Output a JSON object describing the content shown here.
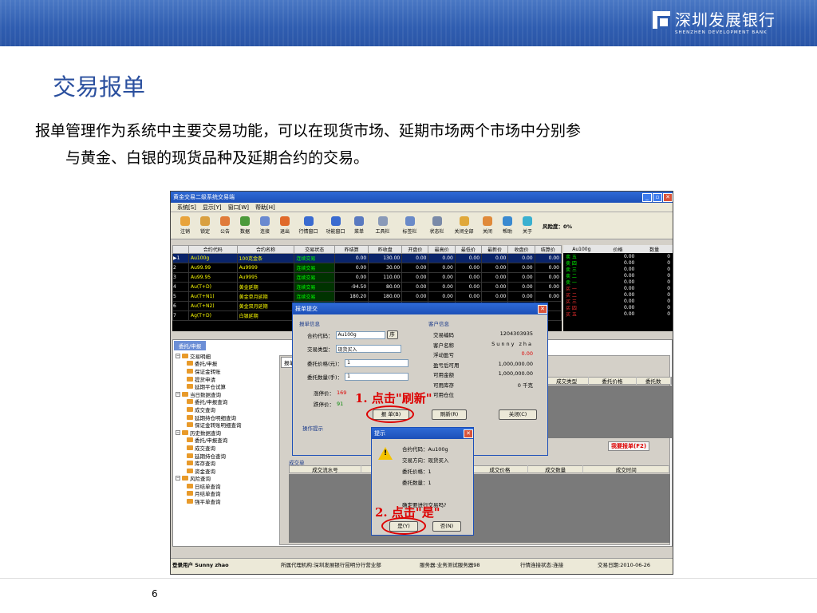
{
  "slide": {
    "title": "交易报单",
    "intro_line1": "报单管理作为系统中主要交易功能，可以在现货市场、延期市场两个市场中分别参",
    "intro_line2": "与黄金、白银的现货品种及延期合约的交易。",
    "page_number": "6",
    "logo_cn": "深圳发展银行",
    "logo_en": "SHENZHEN DEVELOPMENT BANK"
  },
  "app": {
    "title": "黄金交易二级系统交易端",
    "menu": [
      "系统[S]",
      "显示[Y]",
      "窗口[W]",
      "帮助[H]"
    ],
    "toolbar": [
      "注销",
      "锁定",
      "公告",
      "数据",
      "连接",
      "退出",
      "行情窗口",
      "功能窗口",
      "菜单",
      "工具栏",
      "标签栏",
      "状态栏",
      "关闭全部",
      "关闭",
      "帮助",
      "关于"
    ],
    "risk": "风险度：0%",
    "quote_headers": [
      "",
      "合约代码",
      "合约名称",
      "交易状态",
      "昨结算",
      "昨收盘",
      "开盘价",
      "最高价",
      "最低价",
      "最新价",
      "收盘价",
      "结算价"
    ],
    "quote_rows": [
      [
        "▶1",
        "Au100g",
        "100克金条",
        "连续交易",
        "0.00",
        "130.00",
        "0.00",
        "0.00",
        "0.00",
        "0.00",
        "0.00",
        "0.00"
      ],
      [
        "2",
        "Au99.99",
        "Au9999",
        "连续交易",
        "0.00",
        "30.00",
        "0.00",
        "0.00",
        "0.00",
        "0.00",
        "0.00",
        "0.00"
      ],
      [
        "3",
        "Au99.95",
        "Au9995",
        "连续交易",
        "0.00",
        "110.00",
        "0.00",
        "0.00",
        "0.00",
        "0.00",
        "0.00",
        "0.00"
      ],
      [
        "4",
        "Au(T+D)",
        "黄金延期",
        "连续交易",
        "-94.50",
        "80.00",
        "0.00",
        "0.00",
        "0.00",
        "0.00",
        "0.00",
        "0.00"
      ],
      [
        "5",
        "Au(T+N1)",
        "黄金单月延期",
        "连续交易",
        "180.20",
        "180.00",
        "0.00",
        "0.00",
        "0.00",
        "0.00",
        "0.00",
        "0.00"
      ],
      [
        "6",
        "Au(T+N2)",
        "黄金双月延期",
        "连续交",
        "",
        "",
        "",
        "",
        "",
        "",
        "",
        ""
      ],
      [
        "7",
        "Ag(T+D)",
        "白银延期",
        "连续交",
        "",
        "",
        "",
        "",
        "",
        "",
        "",
        ""
      ]
    ],
    "depth": {
      "contract": "Au100g",
      "headers": [
        "Au100g",
        "价格",
        "数量"
      ],
      "rows": [
        [
          "卖 五",
          "0.00",
          "0"
        ],
        [
          "卖 四",
          "0.00",
          "0"
        ],
        [
          "卖 三",
          "0.00",
          "0"
        ],
        [
          "卖 二",
          "0.00",
          "0"
        ],
        [
          "卖 一",
          "0.00",
          "0"
        ],
        [
          "买 一",
          "0.00",
          "0"
        ],
        [
          "买 二",
          "0.00",
          "0"
        ],
        [
          "买 三",
          "0.00",
          "0"
        ],
        [
          "买 四",
          "0.00",
          "0"
        ],
        [
          "买 五",
          "0.00",
          "0"
        ]
      ]
    },
    "lower_tab": "委托/申报",
    "tree": [
      {
        "label": "交易明细",
        "level": 0,
        "exp": true
      },
      {
        "label": "委托/申报",
        "level": 1
      },
      {
        "label": "保证金转账",
        "level": 1
      },
      {
        "label": "提货申请",
        "level": 1
      },
      {
        "label": "延期平仓试算",
        "level": 1
      },
      {
        "label": "当日数据查询",
        "level": 0,
        "exp": true
      },
      {
        "label": "委托/申报查询",
        "level": 1
      },
      {
        "label": "成交查询",
        "level": 1
      },
      {
        "label": "延期持仓明细查询",
        "level": 1
      },
      {
        "label": "保证金转账明细查询",
        "level": 1
      },
      {
        "label": "历史数据查询",
        "level": 0,
        "exp": true
      },
      {
        "label": "委托/申报查询",
        "level": 1
      },
      {
        "label": "成交查询",
        "level": 1
      },
      {
        "label": "延期持仓查询",
        "level": 1
      },
      {
        "label": "库存查询",
        "level": 1
      },
      {
        "label": "资金查询",
        "level": 1
      },
      {
        "label": "风险查询",
        "level": 0,
        "exp": true
      },
      {
        "label": "日结单查询",
        "level": 1
      },
      {
        "label": "月结单查询",
        "level": 1
      },
      {
        "label": "强平单查询",
        "level": 1
      }
    ],
    "right_tab": "报单",
    "order_grid_headers": [
      "成交类型",
      "委托价格",
      "委托数"
    ],
    "want_order": "我要报单(F2)",
    "trade_label": "成交单",
    "trade_headers": [
      "成交流水号",
      "类型",
      "成交价格",
      "成交数量",
      "成交时间"
    ],
    "status_bar": {
      "user": "登录用户 Sunny zhao",
      "agency": "所属代理机构:深圳发展银行昆明分行营业部",
      "server": "服务器:业务测试服务器98",
      "conn": "行情连接状态:连接",
      "date": "交易日期:2010-06-26"
    }
  },
  "order_dialog": {
    "title": "报单提交",
    "order_group": "报单信息",
    "client_group": "客户信息",
    "contract_label": "合约代码：",
    "contract_value": "Au100g",
    "seq_button": "序",
    "type_label": "交易类型：",
    "type_value": "现货买入",
    "price_label": "委托价格(元)：",
    "price_value": "1",
    "qty_label": "委托数量(手)：",
    "qty_value": "1",
    "up_label": "涨停价：",
    "up_value": "169",
    "down_label": "跌停价：",
    "down_value": "91",
    "client": [
      [
        "交易编码",
        "1204303935"
      ],
      [
        "客户名称",
        "Sunny zha"
      ],
      [
        "浮动盈亏",
        "0.00"
      ],
      [
        "盈亏后可用",
        "1,000,000.00"
      ],
      [
        "可用金额",
        "1,000,000.00"
      ],
      [
        "可用库存",
        "0 千克"
      ],
      [
        "可用仓位",
        ""
      ]
    ],
    "submit_button": "报 单(B)",
    "refresh_button": "刷新(R)",
    "close_button": "关闭(C)",
    "ops_hint": "操作提示",
    "annotation1": "1. 点击\"刷新\""
  },
  "confirm_dialog": {
    "title": "提示",
    "lines": [
      "合约代码：Au100g",
      "交易方向：现货买入",
      "委托价格：1",
      "委托数量：1",
      "",
      "确定要进行交易吗?"
    ],
    "yes_button": "是(Y)",
    "no_button": "否(N)",
    "annotation2": "2. 点击\"是\""
  }
}
